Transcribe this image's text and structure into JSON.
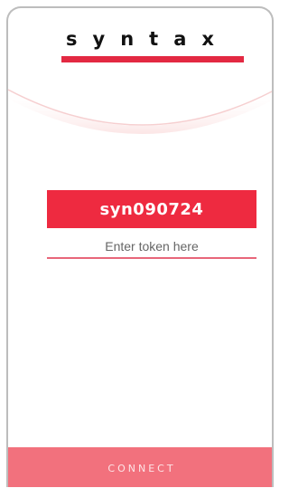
{
  "brand": {
    "name": "syntax",
    "accent_color": "#e32942"
  },
  "token": {
    "value": "syn090724",
    "badge_color": "#ee2a40"
  },
  "token_input": {
    "placeholder": "Enter token here",
    "value": ""
  },
  "actions": {
    "connect_label": "CONNECT",
    "connect_color": "#f2717d"
  }
}
